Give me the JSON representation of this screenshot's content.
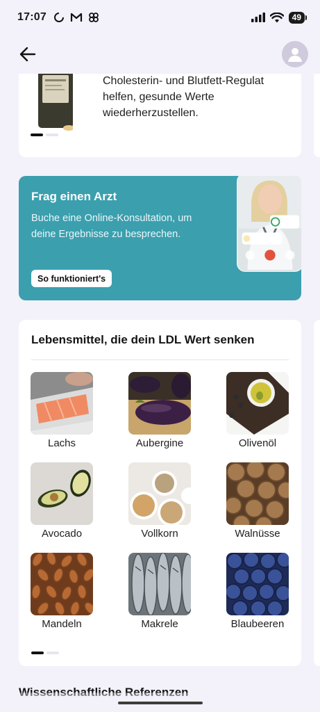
{
  "status_bar": {
    "time": "17:07",
    "battery": "49"
  },
  "supplement": {
    "text_lines": [
      "Cholesterin- und Blutfett-Regulat",
      "helfen, gesunde Werte",
      "wiederherzustellen."
    ]
  },
  "promo": {
    "title": "Frag einen Arzt",
    "text": "Buche eine Online-Konsultation, um deine Ergebnisse zu besprechen.",
    "button": "So funktioniert's"
  },
  "foods": {
    "title": "Lebensmittel, die dein LDL Wert senken",
    "items": [
      {
        "label": "Lachs",
        "icon": "salmon-image"
      },
      {
        "label": "Aubergine",
        "icon": "eggplant-image"
      },
      {
        "label": "Olivenöl",
        "icon": "olive-oil-image"
      },
      {
        "label": "Avocado",
        "icon": "avocado-image"
      },
      {
        "label": "Vollkorn",
        "icon": "whole-grain-image"
      },
      {
        "label": "Walnüsse",
        "icon": "walnuts-image"
      },
      {
        "label": "Mandeln",
        "icon": "almonds-image"
      },
      {
        "label": "Makrele",
        "icon": "mackerel-image"
      },
      {
        "label": "Blaubeeren",
        "icon": "blueberries-image"
      }
    ]
  },
  "references": {
    "title": "Wissenschaftliche Referenzen"
  },
  "colors": {
    "background": "#f3f1fa",
    "promo": "#3b9fae",
    "card": "#ffffff"
  }
}
